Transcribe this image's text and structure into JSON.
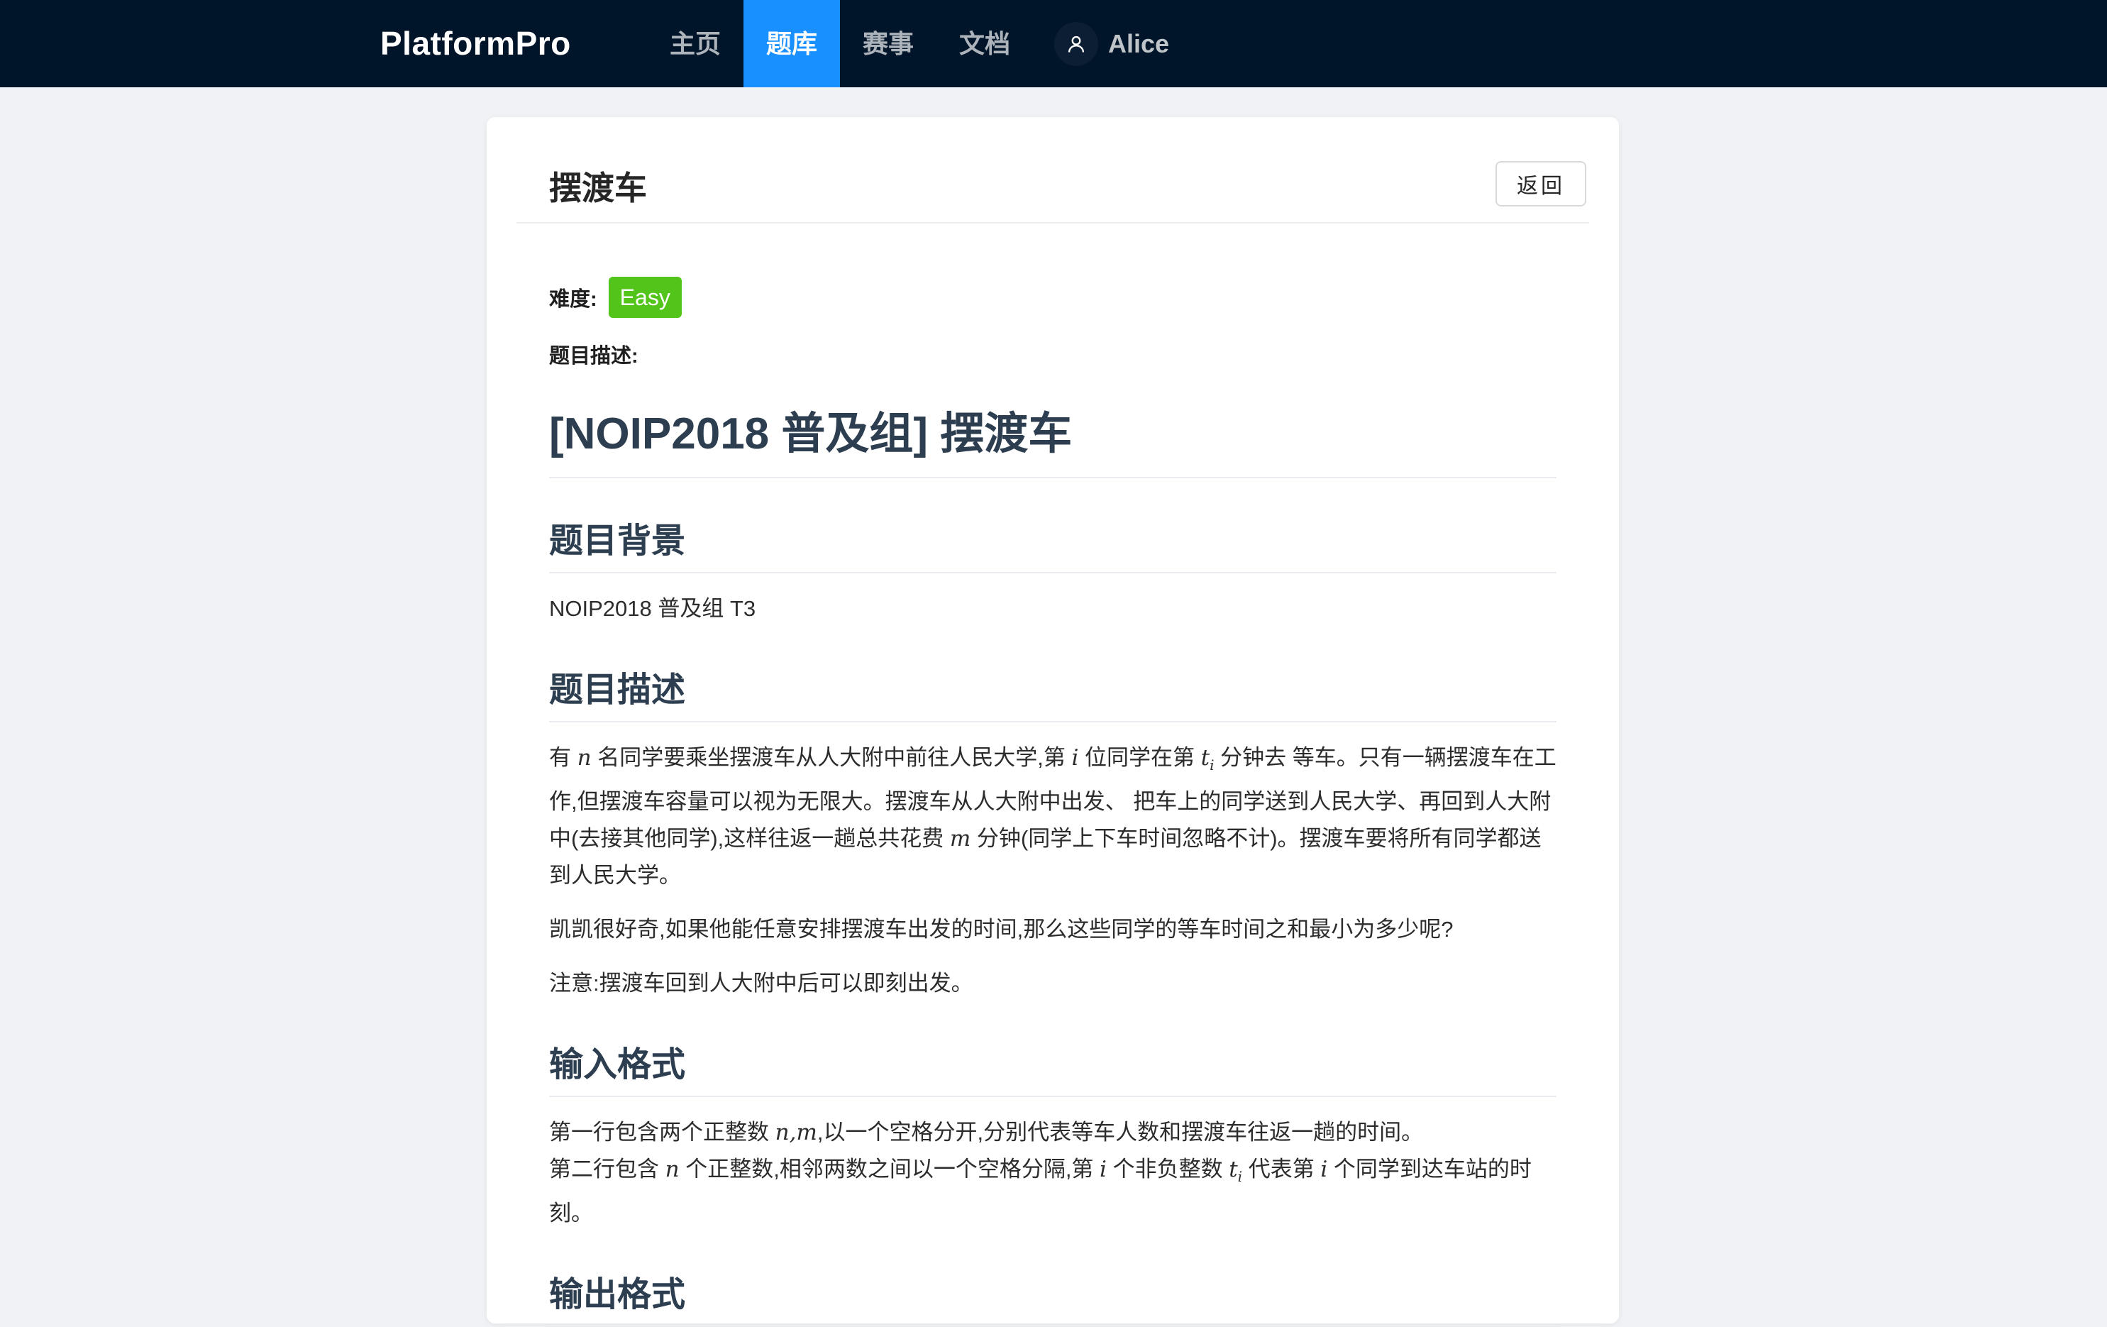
{
  "navbar": {
    "brand": "PlatformPro",
    "items": [
      {
        "label": "主页",
        "active": false
      },
      {
        "label": "题库",
        "active": true
      },
      {
        "label": "赛事",
        "active": false
      },
      {
        "label": "文档",
        "active": false
      }
    ],
    "user": {
      "icon": "user-icon",
      "name": "Alice"
    }
  },
  "card": {
    "title": "摆渡车",
    "back_label": "返回"
  },
  "meta": {
    "difficulty_label": "难度:",
    "difficulty_value": "Easy",
    "description_label": "题目描述:"
  },
  "problem": {
    "title": "[NOIP2018 普及组] 摆渡车",
    "background_heading": "题目背景",
    "background_text": "NOIP2018 普及组 T3",
    "description_heading": "题目描述",
    "desc_p1": {
      "s1": "有 ",
      "v_n": "n",
      "s2": " 名同学要乘坐摆渡车从人大附中前往人民大学,第 ",
      "v_i": "i",
      "s3": " 位同学在第 ",
      "v_t": "t",
      "v_sub": "i",
      "s4": " 分钟去 等车。只有一辆摆渡车在工作,但摆渡车容量可以视为无限大。摆渡车从人大附中出发、 把车上的同学送到人民大学、再回到人大附中(去接其他同学),这样往返一趟总共花费 ",
      "v_m": "m",
      "s5": " 分钟(同学上下车时间忽略不计)。摆渡车要将所有同学都送到人民大学。"
    },
    "desc_p2": "凯凯很好奇,如果他能任意安排摆渡车出发的时间,那么这些同学的等车时间之和最小为多少呢?",
    "desc_p3": "注意:摆渡车回到人大附中后可以即刻出发。",
    "input_heading": "输入格式",
    "input_p": {
      "s1": "第一行包含两个正整数 ",
      "v_nm": "n,m",
      "s2": ",以一个空格分开,分别代表等车人数和摆渡车往返一趟的时间。",
      "s3": "第二行包含 ",
      "v_n": "n",
      "s4": " 个正整数,相邻两数之间以一个空格分隔,第 ",
      "v_i": "i",
      "s5": " 个非负整数 ",
      "v_t": "t",
      "v_sub": "i",
      "s6": " 代表第 ",
      "v_i2": "i",
      "s7": " 个同学到达车站的时刻。"
    },
    "output_heading": "输出格式"
  },
  "colors": {
    "navbar_bg": "#001529",
    "nav_active_bg": "#1890ff",
    "difficulty_tag": "#52c41a",
    "heading_text": "#2c3e50",
    "page_bg": "#f0f2f5"
  }
}
